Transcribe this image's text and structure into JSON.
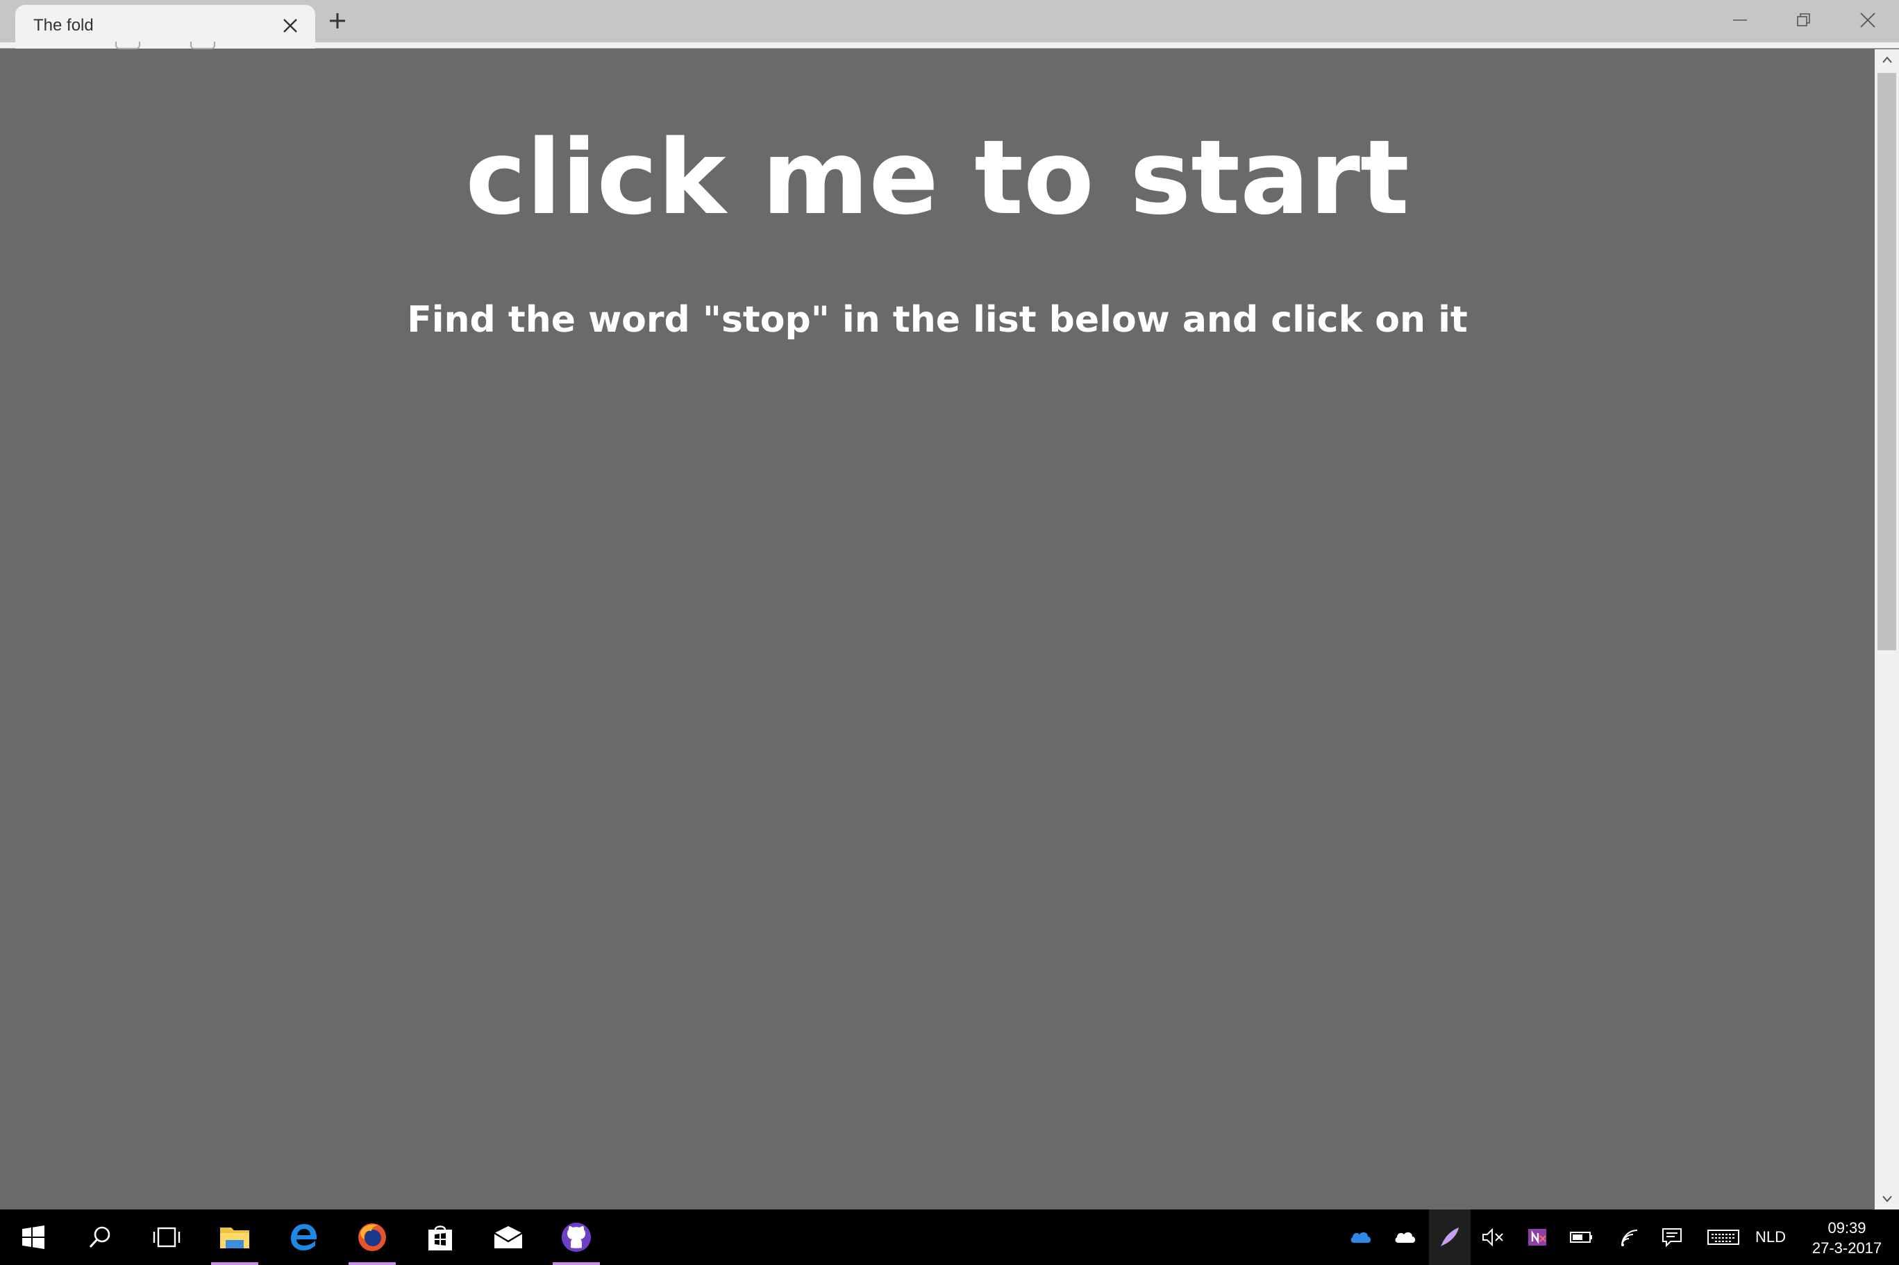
{
  "browser": {
    "tab_title": "The fold"
  },
  "page": {
    "headline": "click me to start",
    "instruction": "Find the word \"stop\" in the list below and click on it"
  },
  "taskbar": {
    "pinned_icons": [
      "windows-start-icon",
      "search-icon",
      "task-view-icon",
      "file-explorer-icon",
      "edge-icon",
      "firefox-icon",
      "store-icon",
      "mail-icon",
      "github-icon"
    ],
    "tray": {
      "language": "NLD",
      "time": "09:39",
      "date": "27-3-2017"
    }
  },
  "colors": {
    "page_background": "#6a6a6a",
    "text": "#ffffff",
    "taskbar": "#000000",
    "active_indicator": "#c58fe8"
  }
}
